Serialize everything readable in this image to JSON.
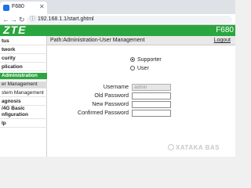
{
  "browser": {
    "tab_title": "F680",
    "tab_close": "✕",
    "back": "←",
    "forward": "→",
    "reload": "↻",
    "lock": "ⓘ",
    "url": "192.168.1.1/start.ghtml"
  },
  "router": {
    "brand": "ZTE",
    "model": "F680"
  },
  "sidebar": {
    "items": [
      {
        "label": "tus"
      },
      {
        "label": "twork"
      },
      {
        "label": "curity"
      },
      {
        "label": "plication"
      },
      {
        "label": "Administration"
      },
      {
        "label": "er Management"
      },
      {
        "label": "stem Management"
      },
      {
        "label": "agnosis"
      },
      {
        "label": "/4G Basic"
      },
      {
        "label": "nfiguration"
      },
      {
        "label": "lp"
      }
    ]
  },
  "main": {
    "path": "Path:Administration-User Management",
    "logout": "Logout",
    "radios": [
      {
        "label": "Supporter",
        "checked": true
      },
      {
        "label": "User",
        "checked": false
      }
    ],
    "fields": [
      {
        "label": "Username",
        "value": "admin",
        "disabled": true
      },
      {
        "label": "Old Password",
        "value": ""
      },
      {
        "label": "New Password",
        "value": ""
      },
      {
        "label": "Confirmed Password",
        "value": ""
      }
    ]
  },
  "watermark": "XATAKA BAS"
}
